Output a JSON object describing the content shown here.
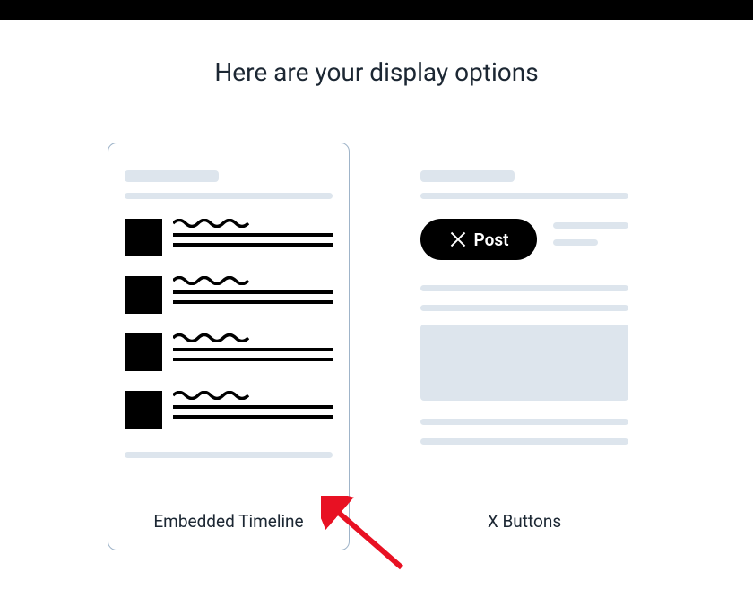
{
  "heading": "Here are your display options",
  "options": {
    "timeline": {
      "label": "Embedded Timeline"
    },
    "buttons": {
      "label": "X Buttons",
      "post_button_text": "Post"
    }
  }
}
